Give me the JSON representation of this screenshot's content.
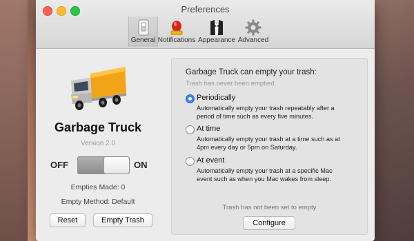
{
  "window": {
    "title": "Preferences"
  },
  "tabs": [
    {
      "label": "General",
      "icon": "switch-icon",
      "selected": true
    },
    {
      "label": "Notifications",
      "icon": "alarm-light-icon",
      "selected": false
    },
    {
      "label": "Appearance",
      "icon": "tuxedo-icon",
      "selected": false
    },
    {
      "label": "Advanced",
      "icon": "gear-icon",
      "selected": false
    }
  ],
  "app": {
    "name": "Garbage Truck",
    "version": "Version 2.0",
    "toggle": {
      "off_label": "OFF",
      "on_label": "ON",
      "state": "on"
    },
    "empties_made": "Empties Made: 0",
    "empty_method": "Empty Method: Default",
    "reset_label": "Reset",
    "empty_trash_label": "Empty Trash"
  },
  "settings": {
    "title": "Garbage Truck can empty your trash:",
    "subtitle": "Trash has never been emptied",
    "options": [
      {
        "label": "Periodically",
        "selected": true,
        "desc1": "Automatically empty your trash repeatably after a",
        "desc2": "period of time such as every five minutes."
      },
      {
        "label": "At time",
        "selected": false,
        "desc1": "Automatically empty your trash at a time such as at",
        "desc2": "4pm every day or 5pm on Saturday."
      },
      {
        "label": "At event",
        "selected": false,
        "desc1": "Automatically empty your trash at a specific Mac",
        "desc2": "event such as when you Mac wakes from sleep."
      }
    ],
    "note": "Trash has not been set to empty",
    "configure_label": "Configure"
  },
  "colors": {
    "accent": "#3a82f0",
    "close": "#fc5f57",
    "minimize": "#fdbc2e",
    "zoom": "#28c840"
  }
}
